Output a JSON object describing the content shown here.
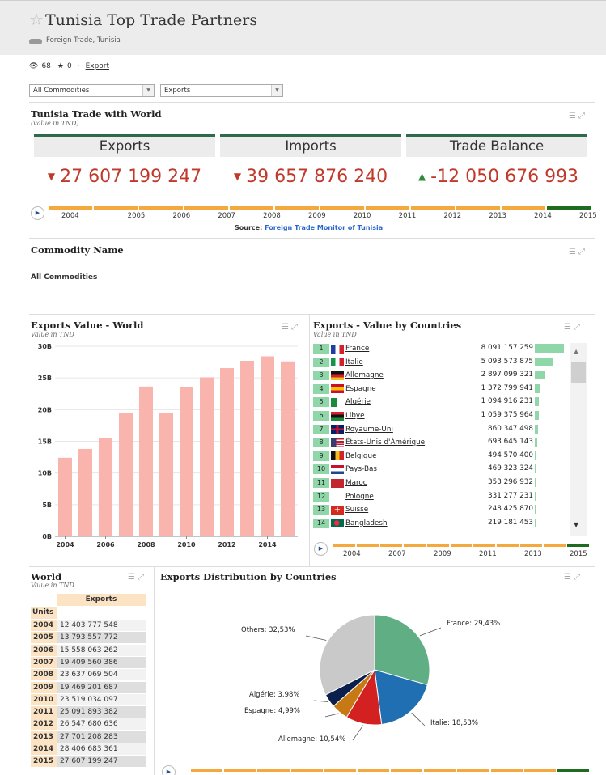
{
  "header": {
    "title": "Tunisia Top Trade Partners",
    "breadcrumb": "Foreign Trade, Tunisia",
    "views": "68",
    "stars": "0",
    "export_link": "Export"
  },
  "filters": {
    "commodity": "All Commodities",
    "flow": "Exports"
  },
  "trade_panel": {
    "title": "Tunisia Trade with World",
    "subtitle": "(value in TND)",
    "kpis": [
      {
        "label": "Exports",
        "value": "27 607 199 247",
        "trend": "down"
      },
      {
        "label": "Imports",
        "value": "39 657 876 240",
        "trend": "down"
      },
      {
        "label": "Trade Balance",
        "value": "-12 050 676 993",
        "trend": "up"
      }
    ],
    "timeline_years": [
      "2004",
      "2005",
      "2006",
      "2007",
      "2008",
      "2009",
      "2010",
      "2011",
      "2012",
      "2013",
      "2014",
      "2015"
    ],
    "source_prefix": "Source:",
    "source_link": "Foreign Trade Monitor of Tunisia"
  },
  "commodity_panel": {
    "title": "Commodity Name",
    "value": "All Commodities"
  },
  "exports_world": {
    "title": "Exports Value - World",
    "subtitle": "Value in TND"
  },
  "chart_data": {
    "type": "bar",
    "categories": [
      "2004",
      "2005",
      "2006",
      "2007",
      "2008",
      "2009",
      "2010",
      "2011",
      "2012",
      "2013",
      "2014",
      "2015"
    ],
    "values": [
      12403777548,
      13793557772,
      15558063262,
      19409560386,
      23637069504,
      19469201687,
      23519034097,
      25091893382,
      26547680636,
      27701208283,
      28406683361,
      27607199247
    ],
    "ylim": [
      0,
      30000000000
    ],
    "yticks": [
      "0B",
      "5B",
      "10B",
      "15B",
      "20B",
      "25B",
      "30B"
    ],
    "xticks": [
      "2004",
      "2006",
      "2008",
      "2010",
      "2012",
      "2014"
    ],
    "color": "#f8b4ad"
  },
  "countries_panel": {
    "title": "Exports - Value by Countries",
    "subtitle": "Value in TND",
    "rows": [
      {
        "rank": "1",
        "name": "France",
        "value": "8 091 157 259",
        "num": 8091157259
      },
      {
        "rank": "2",
        "name": "Italie",
        "value": "5 093 573 875",
        "num": 5093573875
      },
      {
        "rank": "3",
        "name": "Allemagne",
        "value": "2 897 099 321",
        "num": 2897099321
      },
      {
        "rank": "4",
        "name": "Espagne",
        "value": "1 372 799 941",
        "num": 1372799941
      },
      {
        "rank": "5",
        "name": "Algérie",
        "value": "1 094 916 231",
        "num": 1094916231
      },
      {
        "rank": "6",
        "name": "Libye",
        "value": "1 059 375 964",
        "num": 1059375964
      },
      {
        "rank": "7",
        "name": "Royaume-Uni",
        "value": "860 347 498",
        "num": 860347498
      },
      {
        "rank": "8",
        "name": "États-Unis d'Amérique",
        "value": "693 645 143",
        "num": 693645143
      },
      {
        "rank": "9",
        "name": "Belgique",
        "value": "494 570 400",
        "num": 494570400
      },
      {
        "rank": "10",
        "name": "Pays-Bas",
        "value": "469 323 324",
        "num": 469323324
      },
      {
        "rank": "11",
        "name": "Maroc",
        "value": "353 296 932",
        "num": 353296932
      },
      {
        "rank": "12",
        "name": "Pologne",
        "value": "331 277 231",
        "num": 331277231
      },
      {
        "rank": "13",
        "name": "Suisse",
        "value": "248 425 870",
        "num": 248425870
      },
      {
        "rank": "14",
        "name": "Bangladesh",
        "value": "219 181 453",
        "num": 219181453
      }
    ],
    "timeline_years": [
      "2004",
      "2007",
      "2009",
      "2011",
      "2013",
      "2015"
    ]
  },
  "world_table": {
    "title": "World",
    "subtitle": "Value in TND",
    "col_header": "Exports",
    "units_label": "Units",
    "rows": [
      {
        "year": "2004",
        "value": "12 403 777 548"
      },
      {
        "year": "2005",
        "value": "13 793 557 772"
      },
      {
        "year": "2006",
        "value": "15 558 063 262"
      },
      {
        "year": "2007",
        "value": "19 409 560 386"
      },
      {
        "year": "2008",
        "value": "23 637 069 504"
      },
      {
        "year": "2009",
        "value": "19 469 201 687"
      },
      {
        "year": "2010",
        "value": "23 519 034 097"
      },
      {
        "year": "2011",
        "value": "25 091 893 382"
      },
      {
        "year": "2012",
        "value": "26 547 680 636"
      },
      {
        "year": "2013",
        "value": "27 701 208 283"
      },
      {
        "year": "2014",
        "value": "28 406 683 361"
      },
      {
        "year": "2015",
        "value": "27 607 199 247"
      }
    ]
  },
  "distribution_panel": {
    "title": "Exports Distribution by Countries",
    "slices": [
      {
        "label": "France: 29,43%",
        "pct": 29.43,
        "color": "#5fae84"
      },
      {
        "label": "Italie: 18,53%",
        "pct": 18.53,
        "color": "#1f6fb2"
      },
      {
        "label": "Allemagne: 10,54%",
        "pct": 10.54,
        "color": "#d32020"
      },
      {
        "label": "Espagne: 4,99%",
        "pct": 4.99,
        "color": "#c77a14"
      },
      {
        "label": "Algérie: 3,98%",
        "pct": 3.98,
        "color": "#0b1f4d"
      },
      {
        "label": "Others: 32,53%",
        "pct": 32.53,
        "color": "#c9c9c9"
      }
    ]
  }
}
